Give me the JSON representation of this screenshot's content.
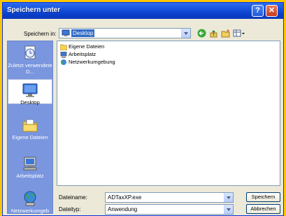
{
  "dialog": {
    "title": "Speichern unter",
    "help_glyph": "?",
    "close_glyph": "✕"
  },
  "lookin": {
    "label": "Speichern in:",
    "value": "Desktop"
  },
  "places": [
    {
      "label": "Zuletzt verwendete D...",
      "icon": "recent-documents-icon"
    },
    {
      "label": "Desktop",
      "icon": "desktop-icon",
      "selected": true
    },
    {
      "label": "Eigene Dateien",
      "icon": "my-documents-icon"
    },
    {
      "label": "Arbeitsplatz",
      "icon": "my-computer-icon"
    },
    {
      "label": "Netzwerkumgeb",
      "icon": "network-places-icon"
    }
  ],
  "files": [
    {
      "name": "Eigene Dateien",
      "icon": "folder-icon"
    },
    {
      "name": "Arbeitsplatz",
      "icon": "computer-icon"
    },
    {
      "name": "Netzwerkumgebung",
      "icon": "network-icon"
    }
  ],
  "filename": {
    "label": "Dateiname:",
    "value": "ADTaxXP.exe"
  },
  "filetype": {
    "label": "Dateityp:",
    "value": "Anwendung"
  },
  "buttons": {
    "save": "Speichern",
    "cancel": "Abbrechen"
  },
  "colors": {
    "titlebar": "#0a3fcb",
    "places_bar": "#7a96df",
    "dialog_bg": "#ece9d8",
    "selection": "#316ac5",
    "background": "#fdc600"
  }
}
